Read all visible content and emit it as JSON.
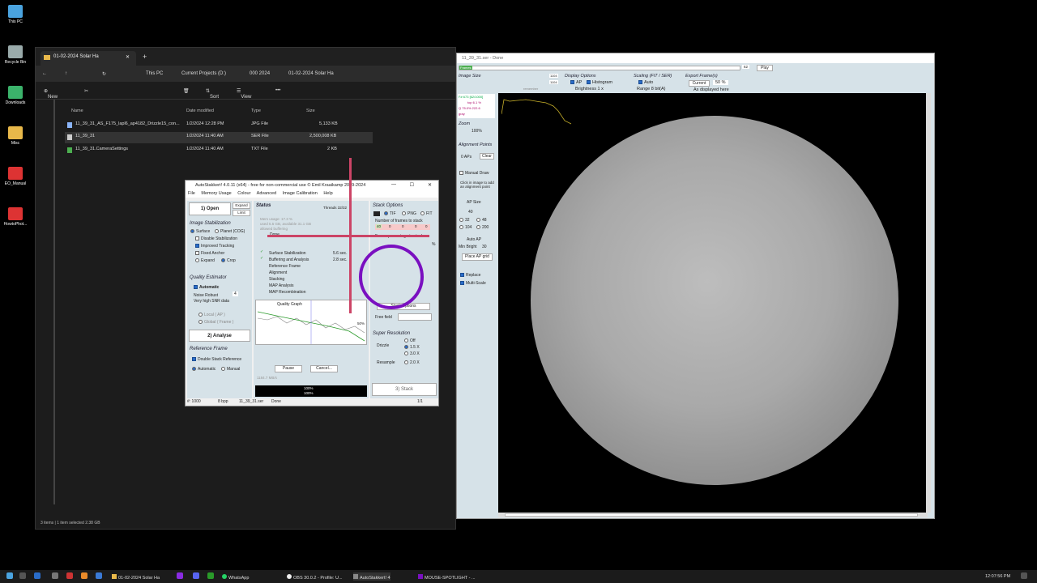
{
  "desktop": {
    "icons": [
      {
        "label": "This PC",
        "color": "#4aa3df"
      },
      {
        "label": "Recycle Bin",
        "color": "#9aa"
      },
      {
        "label": "Downloads",
        "color": "#3bb36b"
      },
      {
        "label": "Misc",
        "color": "#e8b84a"
      },
      {
        "label": "EO_Manual",
        "color": "#d33"
      },
      {
        "label": "HowtoPhot...",
        "color": "#d33"
      }
    ]
  },
  "explorer": {
    "tab_title": "01-02-2024 Solar Ha",
    "breadcrumb": [
      "This PC",
      "Current Projects (D:)",
      "000 2024",
      "01-02-2024 Solar Ha"
    ],
    "toolbar": {
      "new": "New",
      "sort": "Sort",
      "view": "View"
    },
    "columns": [
      "Name",
      "Date modified",
      "Type",
      "Size"
    ],
    "files": [
      {
        "name": "11_39_31_AS_F175_lapl6_ap4182_Drizzle15_con...",
        "date": "1/2/2024 12:28 PM",
        "type": "JPG File",
        "size": "5,133 KB",
        "icon_color": "#8ab4f8"
      },
      {
        "name": "11_39_31",
        "date": "1/2/2024 11:40 AM",
        "type": "SER File",
        "size": "2,500,008 KB",
        "icon_color": "#ccc"
      },
      {
        "name": "11_39_31.CameraSettings",
        "date": "1/2/2024 11:40 AM",
        "type": "TXT File",
        "size": "2 KB",
        "icon_color": "#4caf50"
      }
    ],
    "status": "3 items  |  1 item selected  2.38 GB"
  },
  "autostakkert": {
    "title": "AutoStakkert! 4.0.11 (x64) - free for non-commercial use © Emil Kraaikamp 2009-2024",
    "menu": [
      "File",
      "Memory Usage",
      "Colour",
      "Advanced",
      "Image Calibration",
      "Help"
    ],
    "open_btn": "1) Open",
    "expand": "Expand",
    "limit": "Limit",
    "image_stabilization": "Image Stabilization",
    "surface": "Surface",
    "planet": "Planet (COG)",
    "disable_stab": "Disable Stabilization",
    "improved_tracking": "Improved Tracking",
    "fixed_anchor": "Fixed Anchor",
    "expand_opt": "Expand",
    "crop_opt": "Crop",
    "quality_estimator": "Quality Estimator",
    "automatic": "Automatic",
    "noise_robust": "Noise Robust",
    "noise_robust_val": "4",
    "very_high_snr": "Very high SNR data",
    "local": "Local",
    "local_ap": "( AP )",
    "global": "Global",
    "global_frame": "( Frame )",
    "analyse_btn": "2) Analyse",
    "reference_frame": "Reference Frame",
    "double_stack": "Double Stack Reference",
    "ref_automatic": "Automatic",
    "ref_manual": "Manual",
    "status_label": "Status",
    "threads": "Threads 32/32",
    "mem_usage": "Mem usage: 17.3 %",
    "mem_line2": "used 5.5 GB, available 31.1 GB",
    "mem_line3": "allowed buffering",
    "done": "Done",
    "steps": [
      {
        "label": "Surface Stabilization",
        "time": "5.6 sec."
      },
      {
        "label": "Buffering and Analysis",
        "time": "2.8 sec."
      },
      {
        "label": "Reference Frame",
        "time": ""
      },
      {
        "label": "Alignment",
        "time": ""
      },
      {
        "label": "Stacking",
        "time": ""
      },
      {
        "label": "MAP Analysis",
        "time": ""
      },
      {
        "label": "MAP Recombination",
        "time": ""
      }
    ],
    "quality_graph": "Quality Graph",
    "graph_pct": "50%",
    "pause": "Pause",
    "cancel": "Cancel...",
    "speed": "1184.7 MB/s",
    "progress1": "100%",
    "progress2": "100%",
    "stack_options": "Stack Options",
    "tif": "TIF",
    "png": "PNG",
    "fit": "FIT",
    "num_frames": "Number of frames to stack",
    "frame_pct": "Frame percentage to stack",
    "stack_vals": [
      "40",
      "0",
      "0",
      "0",
      "0"
    ],
    "pct_sign": "%",
    "stack_options_btn": "Stack Options",
    "free_field": "Free field",
    "super_resolution": "Super Resolution",
    "drizzle": "Drizzle",
    "off": "Off",
    "x15": "1.5 X",
    "x30": "3.0 X",
    "resample": "Resample",
    "x20": "2.0 X",
    "stack_btn": "3) Stack",
    "status_frames": "#: 1000",
    "status_bpp": "8 bpp",
    "status_file": "11_39_31.ser",
    "status_done": "Done",
    "status_page": "1/1"
  },
  "viewer": {
    "title": "11_39_31.ser - Done",
    "frames_label": "Frames",
    "play": "Play",
    "frame_num": "62",
    "image_size": "Image Size",
    "size1": "1104",
    "size2": "1104",
    "remember": "remember",
    "display_options": "Display Options",
    "ap_label": "AP",
    "histogram": "Histogram",
    "brightness": "Brightness 1 x",
    "scaling": "Scaling (FIT / SER)",
    "auto": "Auto",
    "range": "Range 8 bit(A)",
    "export_frames": "Export Frame(s)",
    "current": "Current",
    "pct50": "50 %",
    "as_displayed": "As displayed here",
    "info1": "F# 673 [62/1000]",
    "info2": "top 6.1 %",
    "info3": "Q 75.0%  222.6",
    "info4": "gray",
    "zoom": "Zoom",
    "zoom_val": "100%",
    "alignment_points": "Alignment Points",
    "aps": "0 APs",
    "clear": "Clear",
    "manual_draw": "Manual Draw",
    "click_hint": "Click in image to add an alignment point",
    "ap_size": "AP Size",
    "ap_sizes": [
      "40",
      "32",
      "48",
      "104",
      "200"
    ],
    "auto_ap": "Auto AP",
    "min_bright": "Min Bright",
    "min_bright_val": "30",
    "place_grid": "Place AP grid",
    "replace": "Replace",
    "multi_scale": "Multi-Scale"
  },
  "taskbar": {
    "items": [
      "01-02-2024 Solar Ha",
      "WhatsApp",
      "OBS 30.0.2 - Profile: U...",
      "AutoStakkert! 4",
      "MOUSE-SPOTLIGHT - ..."
    ],
    "time": "12:07:56 PM"
  }
}
